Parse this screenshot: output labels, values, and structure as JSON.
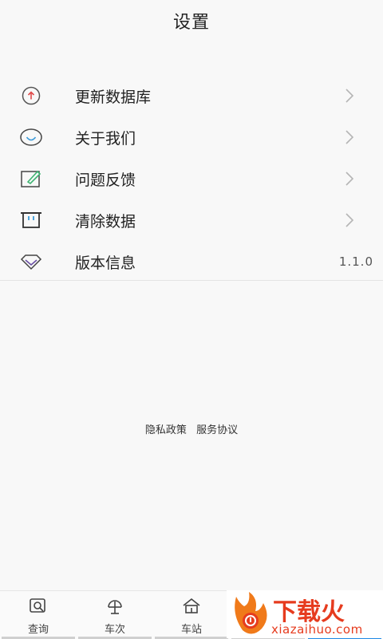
{
  "header": {
    "title": "设置"
  },
  "menu": {
    "items": [
      {
        "label": "更新数据库",
        "icon": "upload-circle-icon"
      },
      {
        "label": "关于我们",
        "icon": "smile-icon"
      },
      {
        "label": "问题反馈",
        "icon": "edit-icon"
      },
      {
        "label": "清除数据",
        "icon": "trash-icon"
      },
      {
        "label": "版本信息",
        "icon": "diamond-icon",
        "value": "1.1.0"
      }
    ]
  },
  "footer_links": {
    "privacy": "隐私政策",
    "service": "服务协议"
  },
  "tabbar": {
    "tabs": [
      {
        "label": "查询",
        "icon": "search-doc-icon"
      },
      {
        "label": "车次",
        "icon": "train-icon"
      },
      {
        "label": "车站",
        "icon": "station-home-icon"
      },
      {
        "label": "",
        "icon": ""
      },
      {
        "label": "",
        "icon": ""
      }
    ]
  },
  "watermark": {
    "text": "下载火",
    "sub": "xiazaihuo.com"
  },
  "colors": {
    "accent": "#1e88e5",
    "update_icon": "#e04848",
    "smile_icon": "#3a9ad9",
    "edit_icon": "#3cb371",
    "diamond_icon": "#6a4fa3"
  }
}
